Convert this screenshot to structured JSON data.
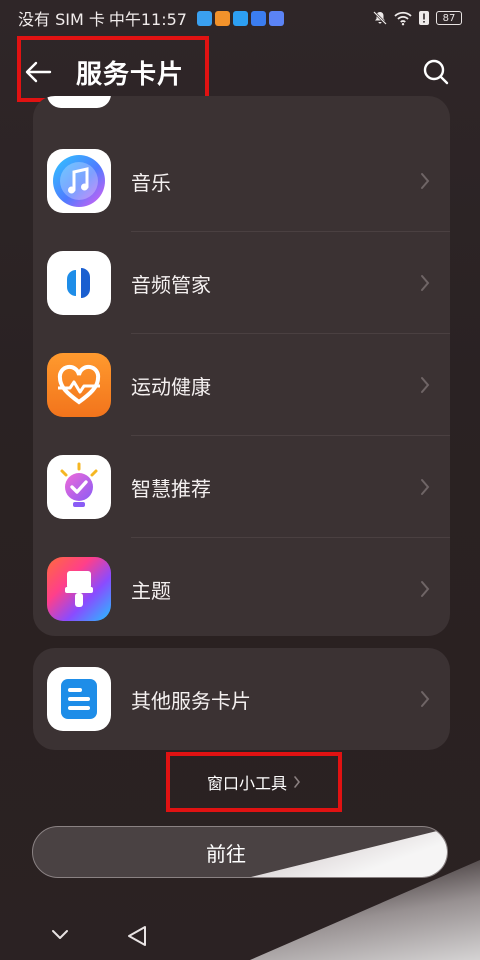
{
  "status_bar": {
    "carrier": "没有 SIM 卡",
    "time": "中午11:57",
    "battery": "87"
  },
  "header": {
    "title": "服务卡片"
  },
  "main_list": [
    {
      "label": "音乐",
      "icon": "music-app-icon"
    },
    {
      "label": "音频管家",
      "icon": "audio-manager-app-icon"
    },
    {
      "label": "运动健康",
      "icon": "health-app-icon"
    },
    {
      "label": "智慧推荐",
      "icon": "smart-recommend-app-icon"
    },
    {
      "label": "主题",
      "icon": "themes-app-icon"
    }
  ],
  "other_list": [
    {
      "label": "其他服务卡片",
      "icon": "other-cards-app-icon"
    }
  ],
  "widget_link": {
    "label": "窗口小工具"
  },
  "go_button": {
    "label": "前往"
  },
  "colors": {
    "background": "#2a2223",
    "card": "#3b3233",
    "highlight": "#e01212"
  }
}
